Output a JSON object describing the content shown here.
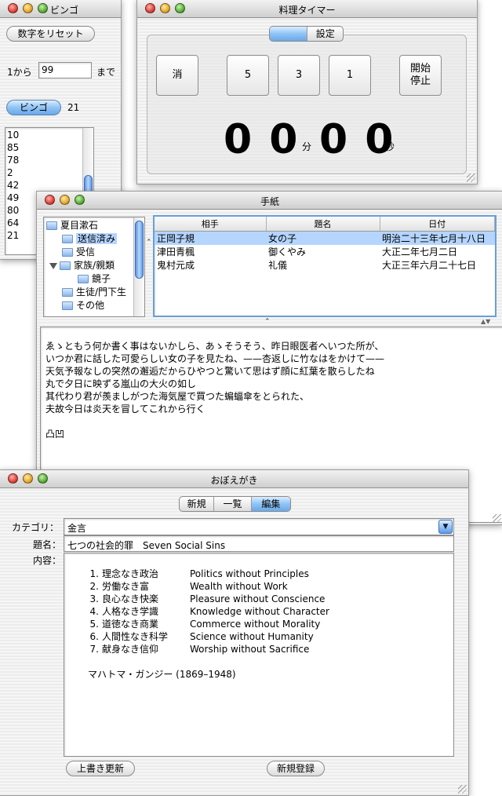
{
  "bingo": {
    "title": "ビンゴ",
    "reset_label": "数字をリセット",
    "from_label": "1から",
    "max_value": "99",
    "to_label": "まで",
    "bingo_label": "ビンゴ",
    "current_number": "21",
    "history": [
      "10",
      "85",
      "78",
      "2",
      "42",
      "49",
      "80",
      "64",
      "21"
    ]
  },
  "timer": {
    "title": "料理タイマー",
    "tabs": [
      "",
      "設定"
    ],
    "clear_label": "消",
    "btn_5": "5",
    "btn_3": "3",
    "btn_1": "1",
    "start_label": "開始",
    "stop_label": "停止",
    "minutes": "0 0",
    "minutes_unit": "分",
    "seconds": "0 0",
    "seconds_unit": "秒"
  },
  "letters": {
    "title": "手紙",
    "tree": {
      "root": "夏目漱石",
      "sent": "送信済み",
      "inbox": "受信",
      "family": "家族/親類",
      "kyoko": "鏡子",
      "students": "生徒/門下生",
      "other": "その他"
    },
    "columns": [
      "相手",
      "題名",
      "日付"
    ],
    "rows": [
      {
        "to": "正岡子規",
        "subject": "女の子",
        "date": "明治二十三年七月十八日"
      },
      {
        "to": "津田青楓",
        "subject": "御くやみ",
        "date": "大正二年七月二日"
      },
      {
        "to": "鬼村元成",
        "subject": "礼儀",
        "date": "大正三年六月二十七日"
      }
    ],
    "body_lines": [
      "ゑゝともう何か書く事はないかしら、あゝそうそう、昨日眼医者へいつた所が、",
      "いつか君に話した可愛らしい女の子を見たね、——杏返しに竹なはをかけて——",
      "天気予報なしの突然の邂逅だからひやつと驚いて思はず顔に紅葉を散らしたね",
      "丸で夕日に映ずる嵐山の大火の如し",
      "其代わり君が羨ましがつた海気屋で買つた蝙蝠傘をとられた、",
      "夫故今日は炎天を冒してこれから行く",
      "",
      "凸凹"
    ]
  },
  "memo": {
    "title": "おぼえがき",
    "tabs": [
      "新規",
      "一覧",
      "編集"
    ],
    "category_label": "カテゴリ：",
    "category_value": "金言",
    "subject_label": "題名：",
    "subject_value": "七つの社会的罪　Seven Social Sins",
    "content_label": "内容：",
    "items": [
      {
        "num": "1.",
        "jp": "理念なき政治",
        "en": "Politics without Principles"
      },
      {
        "num": "2.",
        "jp": "労働なき富",
        "en": "Wealth without Work"
      },
      {
        "num": "3.",
        "jp": "良心なき快楽",
        "en": "Pleasure without Conscience"
      },
      {
        "num": "4.",
        "jp": "人格なき学識",
        "en": "Knowledge without Character"
      },
      {
        "num": "5.",
        "jp": "道徳なき商業",
        "en": "Commerce without Morality"
      },
      {
        "num": "6.",
        "jp": "人間性なき科学",
        "en": "Science without Humanity"
      },
      {
        "num": "7.",
        "jp": "献身なき信仰",
        "en": "Worship without Sacrifice"
      }
    ],
    "attribution": "マハトマ・ガンジー (1869–1948)",
    "update_label": "上書き更新",
    "register_label": "新規登録"
  }
}
